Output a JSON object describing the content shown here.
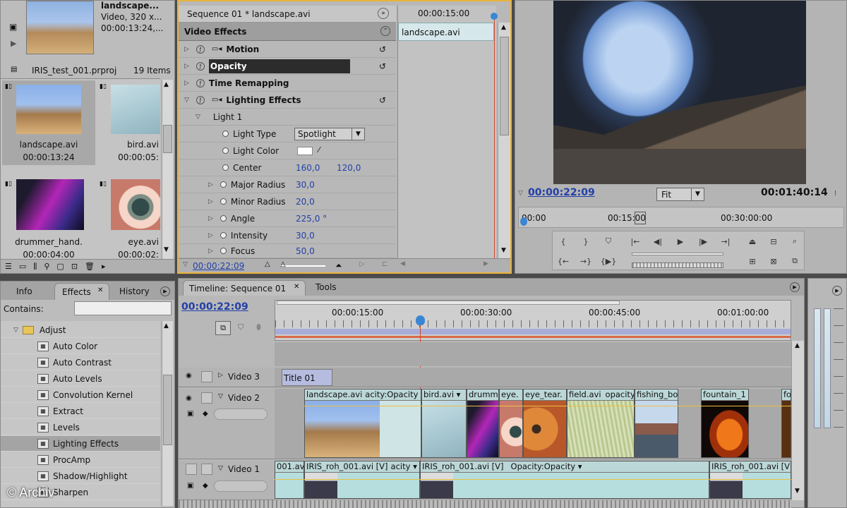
{
  "project": {
    "clip_name": "landscape...",
    "clip_info_1": "Video, 320 x...",
    "clip_info_2": "00:00:13:24,...",
    "project_file": "IRIS_test_001.prproj",
    "item_count": "19 Items",
    "items": [
      {
        "name": "landscape.avi",
        "duration": "00:00:13:24"
      },
      {
        "name": "bird.avi",
        "duration": "00:00:05:"
      },
      {
        "name": "drummer_hand.",
        "duration": "00:00:04:00"
      },
      {
        "name": "eye.avi",
        "duration": "00:00:02:"
      }
    ]
  },
  "effect_controls": {
    "sequence_label": "Sequence 01 * landscape.avi",
    "mini_timecode": "00:00:15:00",
    "clip_label": "landscape.avi",
    "section_title": "Video Effects",
    "effects": [
      "Motion",
      "Opacity",
      "Time Remapping",
      "Lighting Effects"
    ],
    "light_group": "Light 1",
    "props": [
      {
        "label": "Light Type",
        "value": "Spotlight"
      },
      {
        "label": "Light Color",
        "value": ""
      },
      {
        "label": "Center",
        "value": "160,0",
        "value2": "120,0"
      },
      {
        "label": "Major Radius",
        "value": "30,0"
      },
      {
        "label": "Minor Radius",
        "value": "20,0"
      },
      {
        "label": "Angle",
        "value": "225,0 °"
      },
      {
        "label": "Intensity",
        "value": "30,0"
      },
      {
        "label": "Focus",
        "value": "50,0"
      }
    ],
    "footer_timecode": "00:00:22:09"
  },
  "program": {
    "current_time": "00:00:22:09",
    "zoom": "Fit",
    "duration": "00:01:40:14",
    "ruler": [
      "00:00",
      "00:15:00",
      "00:30:00:00"
    ]
  },
  "effects_panel": {
    "tabs": [
      "Info",
      "Effects",
      "History"
    ],
    "contains_label": "Contains:",
    "search_value": "",
    "folder": "Adjust",
    "items": [
      "Auto Color",
      "Auto Contrast",
      "Auto Levels",
      "Convolution Kernel",
      "Extract",
      "Levels",
      "Lighting Effects",
      "ProcAmp",
      "Shadow/Highlight",
      "Sharpen"
    ]
  },
  "timeline": {
    "tab": "Timeline: Sequence 01",
    "tools_tab": "Tools",
    "timecode": "00:00:22:09",
    "ruler": [
      "00:00:15:00",
      "00:00:30:00",
      "00:00:45:00",
      "00:01:00:00"
    ],
    "tracks": {
      "video3": "Video 3",
      "video2": "Video 2",
      "video1": "Video 1"
    },
    "title_clip": "Title 01",
    "v2_clips": [
      "landscape.avi",
      "acity:Opacity",
      "bird.avi",
      "drumme",
      "eye.",
      "eye_tear.",
      "field.avi",
      "opacity",
      "fishing_bo",
      "fountain_1",
      "fo"
    ],
    "v1_clips": [
      "001.avi",
      "IRIS_roh_001.avi [V]",
      "acity",
      "IRIS_roh_001.avi [V]",
      "Opacity:Opacity",
      "IRIS_roh_001.avi [V"
    ]
  },
  "watermark": "© Archiv"
}
